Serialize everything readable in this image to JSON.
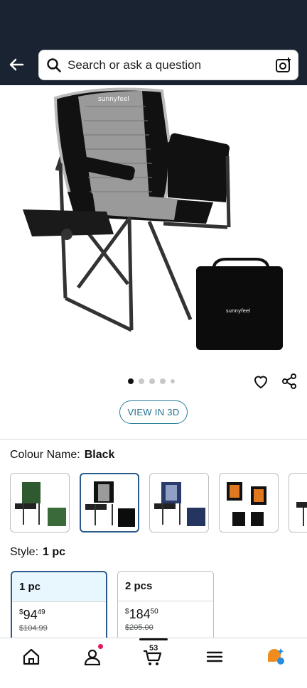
{
  "search": {
    "placeholder": "Search or ask a question"
  },
  "product": {
    "brand_on_chair": "sunnyfeel",
    "view_3d_label": "VIEW IN 3D",
    "image_count": 5,
    "active_image_index": 0
  },
  "colour": {
    "label": "Colour Name:",
    "value": "Black",
    "options": [
      "Green",
      "Black",
      "Blue",
      "Orange"
    ]
  },
  "style": {
    "label": "Style:",
    "value": "1 pc",
    "options": [
      {
        "name": "1 pc",
        "price_symbol": "$",
        "price_whole": "94",
        "price_fraction": "49",
        "old_price": "$104.99"
      },
      {
        "name": "2 pcs",
        "price_symbol": "$",
        "price_whole": "184",
        "price_fraction": "50",
        "old_price": "$205.00"
      }
    ]
  },
  "nav": {
    "cart_count": "53"
  },
  "colors": {
    "header": "#1a2331",
    "accent": "#2a5a8a",
    "link": "#1d6e8c"
  }
}
